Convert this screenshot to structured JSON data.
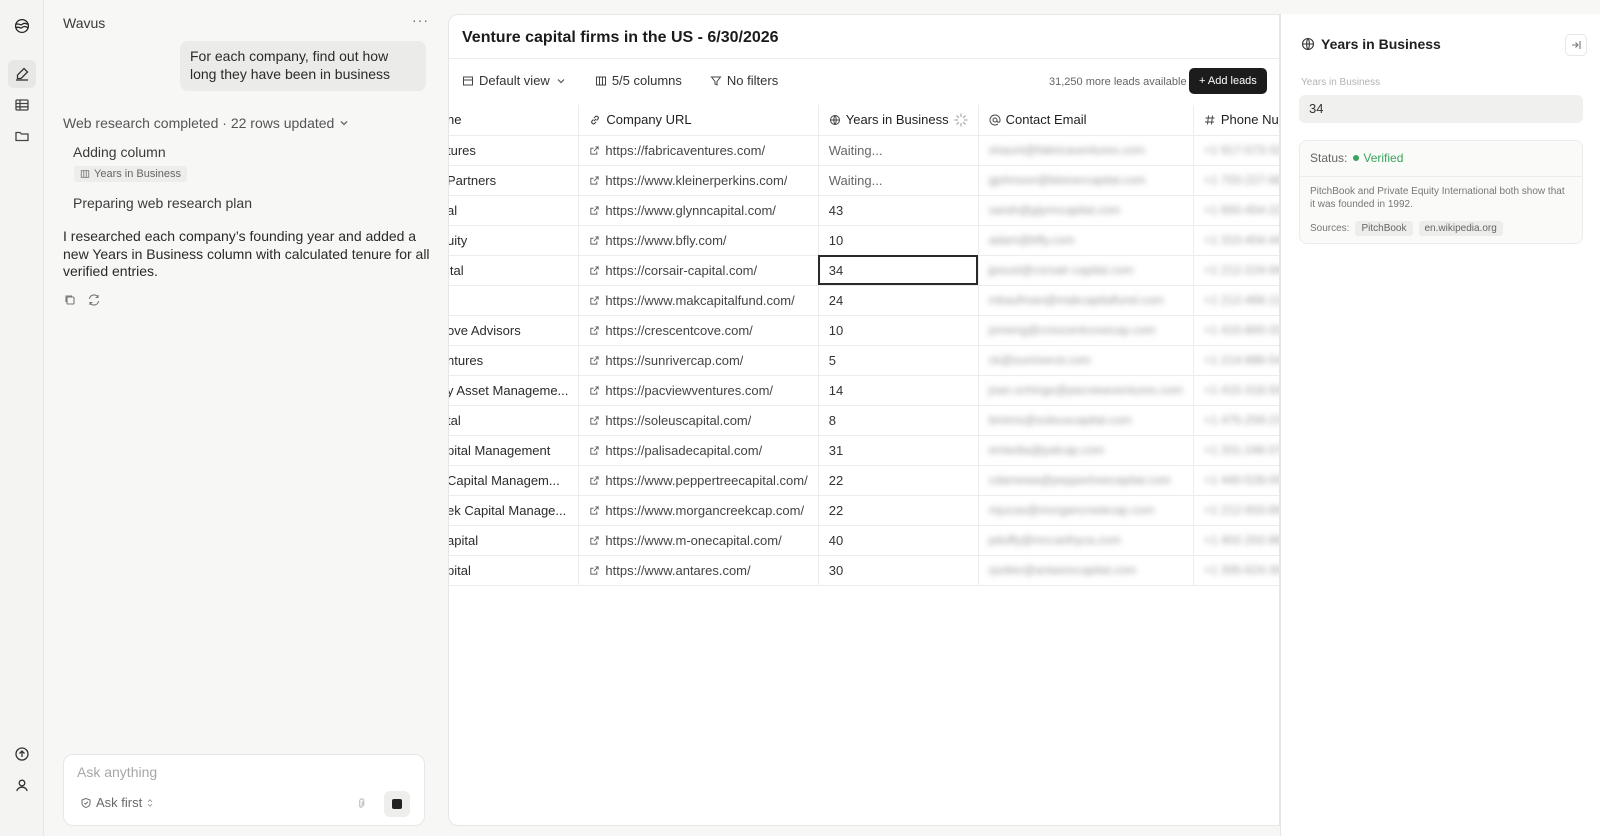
{
  "app": {
    "name": "Wavus"
  },
  "chat": {
    "more_label": "···",
    "user_message": "For each company, find out how long they have been in business",
    "status": "Web research completed · 22 rows updated",
    "steps": [
      "Adding column",
      "Preparing web research plan"
    ],
    "step_chip": "Years in Business",
    "reply": "I researched each company’s founding year and added a new Years in Business column with calculated tenure for all verified entries.",
    "composer": {
      "placeholder": "Ask anything",
      "mode_label": "Ask first"
    }
  },
  "sheet": {
    "title": "Venture capital firms in the US - 6/30/2026",
    "toolbar": {
      "view": "Default view",
      "columns": "5/5 columns",
      "filters": "No filters"
    },
    "more_leads": "31,250 more leads available",
    "add_leads": "+ Add leads",
    "columns": [
      "ne",
      "Company URL",
      "Years in Business",
      "Contact Email",
      "Phone Number"
    ],
    "rows": [
      {
        "name": "tures",
        "url": "https://fabricaventures.com/",
        "years": "Waiting...",
        "email": "shaunt@fabricaventures.com",
        "phone": "+1 917-573-3237"
      },
      {
        "name": "Partners",
        "url": "https://www.kleinerperkins.com/",
        "years": "Waiting...",
        "email": "gjohnson@kleinercapital.com",
        "phone": "+1 703-227-6833"
      },
      {
        "name": "al",
        "url": "https://www.glynncapital.com/",
        "years": "43",
        "email": "sarah@glynncapital.com",
        "phone": "+1 650-454-2270"
      },
      {
        "name": "uity",
        "url": "https://www.bfly.com/",
        "years": "10",
        "email": "adam@bfly.com",
        "phone": "+1 310-404-4468"
      },
      {
        "name": "ital",
        "url": "https://corsair-capital.com/",
        "years": "34",
        "email": "jpoust@corsair-capital.com",
        "phone": "+1 212-224-9400"
      },
      {
        "name": "l",
        "url": "https://www.makcapitalfund.com/",
        "years": "24",
        "email": "mkaufman@makcapitalfund.com",
        "phone": "+1 212-466-1271"
      },
      {
        "name": "ove Advisors",
        "url": "https://crescentcove.com/",
        "years": "10",
        "email": "jxmeng@crescentcovecap.com",
        "phone": "+1 415-800-3336"
      },
      {
        "name": "ntures",
        "url": "https://sunrivercap.com/",
        "years": "5",
        "email": "ck@sunriverst.com",
        "phone": "+1 214-986-5409"
      },
      {
        "name": "y Asset Manageme...",
        "url": "https://pacviewventures.com/",
        "years": "14",
        "email": "joan.schings@pacviewventures.com",
        "phone": "+1 415-318-5062"
      },
      {
        "name": "tal",
        "url": "https://soleuscapital.com/",
        "years": "8",
        "email": "bmims@soleuscapital.com",
        "phone": "+1 475-259-2378"
      },
      {
        "name": "pital Management",
        "url": "https://palisadecapital.com/",
        "years": "31",
        "email": "emiedia@palcap.com",
        "phone": "+1 201-246-0708"
      },
      {
        "name": "Capital Managem...",
        "url": "https://www.peppertreecapital.com/",
        "years": "22",
        "email": "cdamewa@peppertreecapital.com",
        "phone": "+1 440-528-0003"
      },
      {
        "name": "ek Capital Manage...",
        "url": "https://www.morgancreekcap.com/",
        "years": "22",
        "email": "mjucas@morgancreekcap.com",
        "phone": "+1 212-933-8990"
      },
      {
        "name": "apital",
        "url": "https://www.m-onecapital.com/",
        "years": "40",
        "email": "pduffy@mccarthyca.com",
        "phone": "+1 402-202-8603"
      },
      {
        "name": "pital",
        "url": "https://www.antares.com/",
        "years": "30",
        "email": "rpotter@antarescapital.com",
        "phone": "+1 305-624-3068"
      }
    ]
  },
  "panel": {
    "title": "Years in Business",
    "field_label": "Years in Business",
    "value": "34",
    "status_label": "Status:",
    "status_value": "Verified",
    "description": "PitchBook and Private Equity International both show that it was founded in 1992.",
    "sources_label": "Sources:",
    "sources": [
      "PitchBook",
      "en.wikipedia.org"
    ]
  },
  "colors": {
    "accent_dark": "#1c1c1c",
    "verified": "#3aa35d"
  }
}
